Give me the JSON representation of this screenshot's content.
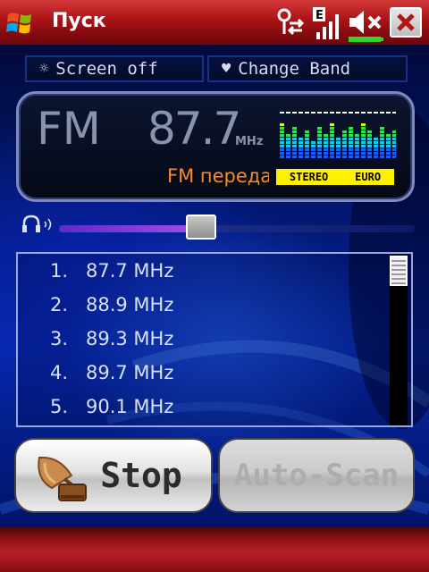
{
  "titlebar": {
    "start_label": "Пуск",
    "icons": [
      "windows-logo-icon",
      "connectivity-icon",
      "edge-signal-icon",
      "volume-muted-icon",
      "battery-icon",
      "close-icon"
    ]
  },
  "controls": {
    "screen_off_label": "Screen off",
    "screen_off_icon": "sun-icon",
    "change_band_label": "Change Band",
    "change_band_icon": "antenna-icon"
  },
  "display": {
    "band": "FM",
    "frequency": "87.7",
    "unit": "MHz",
    "station_name": "FM передача",
    "stereo_label": "STEREO",
    "region_label": "EURO"
  },
  "volume": {
    "icon": "headphones-icon",
    "level": 0.4
  },
  "stations": [
    {
      "num": "1.",
      "freq": "87.7 MHz"
    },
    {
      "num": "2.",
      "freq": "88.9 MHz"
    },
    {
      "num": "3.",
      "freq": "89.3 MHz"
    },
    {
      "num": "4.",
      "freq": "89.7 MHz"
    },
    {
      "num": "5.",
      "freq": "90.1 MHz"
    }
  ],
  "buttons": {
    "stop_label": "Stop",
    "stop_icon": "gramophone-icon",
    "autoscan_label": "Auto-Scan"
  },
  "colors": {
    "station_text": "#ff8a1a",
    "stereo_badge": "#ffef00",
    "titlebar_red": "#b0171a"
  }
}
